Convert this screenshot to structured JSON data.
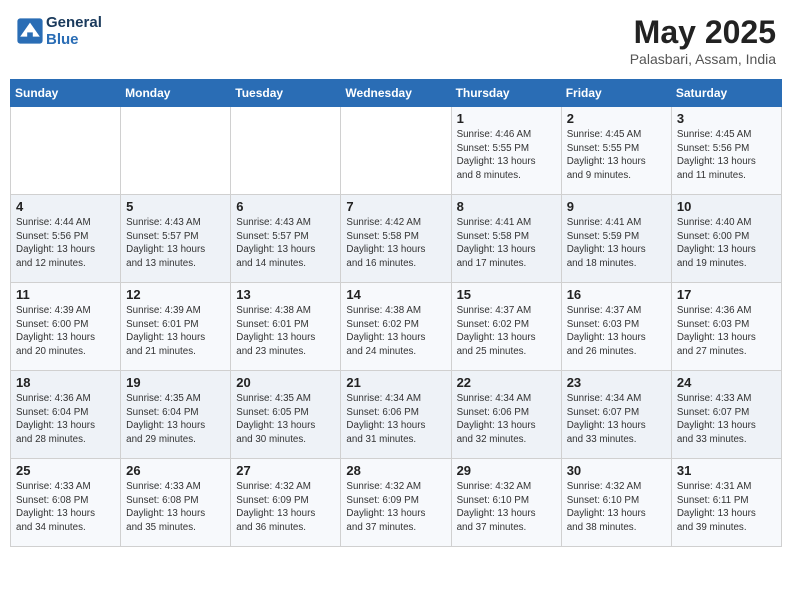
{
  "header": {
    "logo_line1": "General",
    "logo_line2": "Blue",
    "month_year": "May 2025",
    "location": "Palasbari, Assam, India"
  },
  "weekdays": [
    "Sunday",
    "Monday",
    "Tuesday",
    "Wednesday",
    "Thursday",
    "Friday",
    "Saturday"
  ],
  "weeks": [
    [
      {
        "day": "",
        "info": ""
      },
      {
        "day": "",
        "info": ""
      },
      {
        "day": "",
        "info": ""
      },
      {
        "day": "",
        "info": ""
      },
      {
        "day": "1",
        "info": "Sunrise: 4:46 AM\nSunset: 5:55 PM\nDaylight: 13 hours\nand 8 minutes."
      },
      {
        "day": "2",
        "info": "Sunrise: 4:45 AM\nSunset: 5:55 PM\nDaylight: 13 hours\nand 9 minutes."
      },
      {
        "day": "3",
        "info": "Sunrise: 4:45 AM\nSunset: 5:56 PM\nDaylight: 13 hours\nand 11 minutes."
      }
    ],
    [
      {
        "day": "4",
        "info": "Sunrise: 4:44 AM\nSunset: 5:56 PM\nDaylight: 13 hours\nand 12 minutes."
      },
      {
        "day": "5",
        "info": "Sunrise: 4:43 AM\nSunset: 5:57 PM\nDaylight: 13 hours\nand 13 minutes."
      },
      {
        "day": "6",
        "info": "Sunrise: 4:43 AM\nSunset: 5:57 PM\nDaylight: 13 hours\nand 14 minutes."
      },
      {
        "day": "7",
        "info": "Sunrise: 4:42 AM\nSunset: 5:58 PM\nDaylight: 13 hours\nand 16 minutes."
      },
      {
        "day": "8",
        "info": "Sunrise: 4:41 AM\nSunset: 5:58 PM\nDaylight: 13 hours\nand 17 minutes."
      },
      {
        "day": "9",
        "info": "Sunrise: 4:41 AM\nSunset: 5:59 PM\nDaylight: 13 hours\nand 18 minutes."
      },
      {
        "day": "10",
        "info": "Sunrise: 4:40 AM\nSunset: 6:00 PM\nDaylight: 13 hours\nand 19 minutes."
      }
    ],
    [
      {
        "day": "11",
        "info": "Sunrise: 4:39 AM\nSunset: 6:00 PM\nDaylight: 13 hours\nand 20 minutes."
      },
      {
        "day": "12",
        "info": "Sunrise: 4:39 AM\nSunset: 6:01 PM\nDaylight: 13 hours\nand 21 minutes."
      },
      {
        "day": "13",
        "info": "Sunrise: 4:38 AM\nSunset: 6:01 PM\nDaylight: 13 hours\nand 23 minutes."
      },
      {
        "day": "14",
        "info": "Sunrise: 4:38 AM\nSunset: 6:02 PM\nDaylight: 13 hours\nand 24 minutes."
      },
      {
        "day": "15",
        "info": "Sunrise: 4:37 AM\nSunset: 6:02 PM\nDaylight: 13 hours\nand 25 minutes."
      },
      {
        "day": "16",
        "info": "Sunrise: 4:37 AM\nSunset: 6:03 PM\nDaylight: 13 hours\nand 26 minutes."
      },
      {
        "day": "17",
        "info": "Sunrise: 4:36 AM\nSunset: 6:03 PM\nDaylight: 13 hours\nand 27 minutes."
      }
    ],
    [
      {
        "day": "18",
        "info": "Sunrise: 4:36 AM\nSunset: 6:04 PM\nDaylight: 13 hours\nand 28 minutes."
      },
      {
        "day": "19",
        "info": "Sunrise: 4:35 AM\nSunset: 6:04 PM\nDaylight: 13 hours\nand 29 minutes."
      },
      {
        "day": "20",
        "info": "Sunrise: 4:35 AM\nSunset: 6:05 PM\nDaylight: 13 hours\nand 30 minutes."
      },
      {
        "day": "21",
        "info": "Sunrise: 4:34 AM\nSunset: 6:06 PM\nDaylight: 13 hours\nand 31 minutes."
      },
      {
        "day": "22",
        "info": "Sunrise: 4:34 AM\nSunset: 6:06 PM\nDaylight: 13 hours\nand 32 minutes."
      },
      {
        "day": "23",
        "info": "Sunrise: 4:34 AM\nSunset: 6:07 PM\nDaylight: 13 hours\nand 33 minutes."
      },
      {
        "day": "24",
        "info": "Sunrise: 4:33 AM\nSunset: 6:07 PM\nDaylight: 13 hours\nand 33 minutes."
      }
    ],
    [
      {
        "day": "25",
        "info": "Sunrise: 4:33 AM\nSunset: 6:08 PM\nDaylight: 13 hours\nand 34 minutes."
      },
      {
        "day": "26",
        "info": "Sunrise: 4:33 AM\nSunset: 6:08 PM\nDaylight: 13 hours\nand 35 minutes."
      },
      {
        "day": "27",
        "info": "Sunrise: 4:32 AM\nSunset: 6:09 PM\nDaylight: 13 hours\nand 36 minutes."
      },
      {
        "day": "28",
        "info": "Sunrise: 4:32 AM\nSunset: 6:09 PM\nDaylight: 13 hours\nand 37 minutes."
      },
      {
        "day": "29",
        "info": "Sunrise: 4:32 AM\nSunset: 6:10 PM\nDaylight: 13 hours\nand 37 minutes."
      },
      {
        "day": "30",
        "info": "Sunrise: 4:32 AM\nSunset: 6:10 PM\nDaylight: 13 hours\nand 38 minutes."
      },
      {
        "day": "31",
        "info": "Sunrise: 4:31 AM\nSunset: 6:11 PM\nDaylight: 13 hours\nand 39 minutes."
      }
    ]
  ]
}
